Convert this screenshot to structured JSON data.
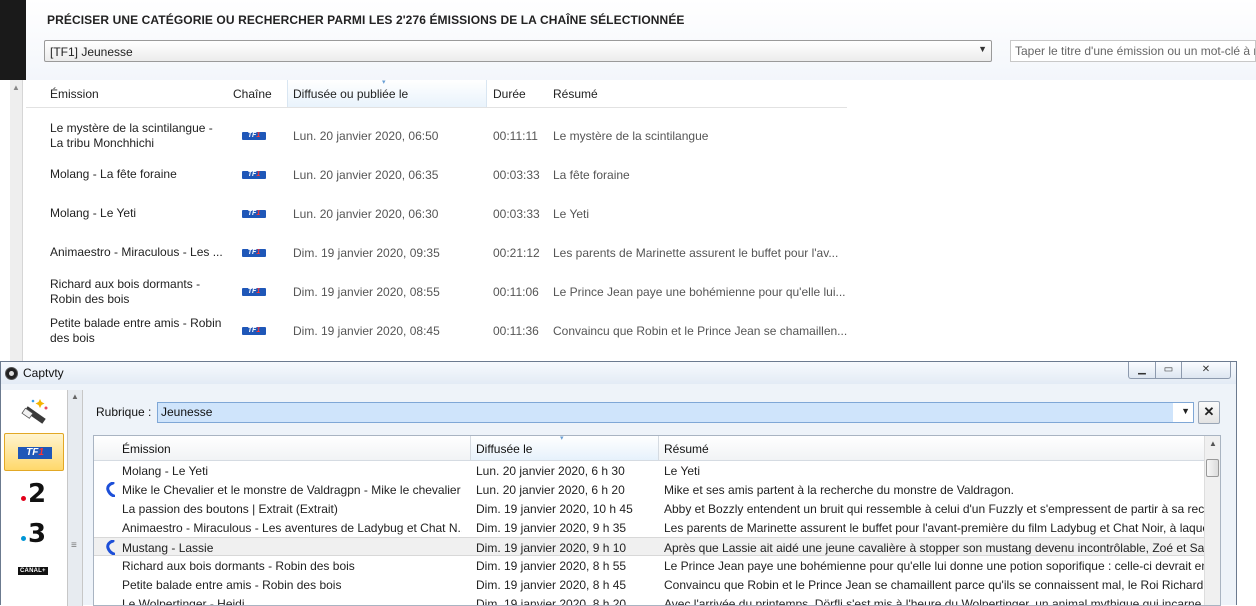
{
  "background": {
    "title": "PRÉCISER UNE CATÉGORIE OU RECHERCHER PARMI LES 2'276 ÉMISSIONS DE LA CHAÎNE SÉLECTIONNÉE",
    "category_select": "[TF1] Jeunesse",
    "search_placeholder": "Taper le titre d'une émission ou un mot-clé à r",
    "columns": [
      "Émission",
      "Chaîne",
      "Diffusée ou publiée le",
      "Durée",
      "Résumé"
    ],
    "rows": [
      {
        "title": "Le mystère de la scintilangue - La tribu Monchhichi",
        "channel": "TF1",
        "date": "Lun. 20 janvier 2020, 06:50",
        "duration": "00:11:11",
        "summary": "Le mystère de la scintilangue"
      },
      {
        "title": "Molang - La fête foraine",
        "channel": "TF1",
        "date": "Lun. 20 janvier 2020, 06:35",
        "duration": "00:03:33",
        "summary": "La fête foraine"
      },
      {
        "title": "Molang - Le Yeti",
        "channel": "TF1",
        "date": "Lun. 20 janvier 2020, 06:30",
        "duration": "00:03:33",
        "summary": "Le Yeti"
      },
      {
        "title": "Animaestro - Miraculous - Les ...",
        "channel": "TF1",
        "date": "Dim. 19 janvier 2020, 09:35",
        "duration": "00:21:12",
        "summary": "Les parents de Marinette assurent le buffet pour l'av..."
      },
      {
        "title": "Richard aux bois dormants - Robin des bois",
        "channel": "TF1",
        "date": "Dim. 19 janvier 2020, 08:55",
        "duration": "00:11:06",
        "summary": "Le Prince Jean paye une bohémienne pour qu'elle lui..."
      },
      {
        "title": "Petite balade entre amis - Robin des bois",
        "channel": "TF1",
        "date": "Dim. 19 janvier 2020, 08:45",
        "duration": "00:11:36",
        "summary": "Convaincu que Robin et le Prince Jean se chamaillen..."
      }
    ]
  },
  "window": {
    "title": "Captvty",
    "min_glyph": "▁",
    "max_glyph": "▭",
    "close_glyph": "✕",
    "rubrique_label": "Rubrique :",
    "rubrique_value": "Jeunesse",
    "clear_glyph": "✕",
    "channels": [
      {
        "name": "tools",
        "icon": "magic-wand-icon"
      },
      {
        "name": "TF1",
        "selected": true
      },
      {
        "name": "France 2",
        "label": "2"
      },
      {
        "name": "France 3",
        "label": "3"
      },
      {
        "name": "CANAL+",
        "label": "CANAL+"
      }
    ],
    "columns": [
      "Émission",
      "Diffusée le",
      "Résumé"
    ],
    "rows": [
      {
        "title": "Molang - Le Yeti",
        "date": "Lun. 20 janvier 2020, 6 h 30",
        "summary": "Le Yeti",
        "flag": false
      },
      {
        "title": "Mike le Chevalier et le monstre de Valdragpn - Mike le chevalier",
        "date": "Lun. 20 janvier 2020, 6 h 20",
        "summary": "Mike et ses amis partent à la recherche du monstre de Valdragon.",
        "flag": true
      },
      {
        "title": "La passion des boutons | Extrait (Extrait)",
        "date": "Dim. 19 janvier 2020, 10 h 45",
        "summary": "Abby et Bozzly entendent un bruit qui ressemble à celui d'un Fuzzly et s'empressent de partir à sa reche",
        "flag": false
      },
      {
        "title": "Animaestro - Miraculous - Les aventures de Ladybug et Chat N...",
        "date": "Dim. 19 janvier 2020, 9 h 35",
        "summary": "Les parents de Marinette assurent le buffet pour l'avant-première du film Ladybug et Chat Noir, à laque",
        "flag": false
      },
      {
        "title": "Mustang - Lassie",
        "date": "Dim. 19 janvier 2020, 9 h 10",
        "summary": "Après que Lassie ait aidé une jeune cavalière à stopper son mustang devenu incontrôlable, Zoé et Sarah",
        "flag": true,
        "selected": true
      },
      {
        "title": "Richard aux bois dormants - Robin des bois",
        "date": "Dim. 19 janvier 2020, 8 h 55",
        "summary": "Le Prince Jean paye une bohémienne pour qu'elle lui donne une potion soporifique : celle-ci devrait en",
        "flag": false
      },
      {
        "title": "Petite balade entre amis - Robin des bois",
        "date": "Dim. 19 janvier 2020, 8 h 45",
        "summary": "Convaincu que Robin et le Prince Jean se chamaillent parce qu'ils se connaissent mal, le Roi Richard or",
        "flag": false
      },
      {
        "title": "Le Wolpertinger - Heidi",
        "date": "Dim. 19 janvier 2020, 8 h 20",
        "summary": "Avec l'arrivée du printemps, Dörfli s'est mis à l'heure du Wolpertinger, un animal mythique qui incarne",
        "flag": false
      }
    ]
  },
  "colors": {
    "accent": "#1f57b8",
    "selection": "#cfe4fb",
    "flag": "#1d4fd8",
    "tf1_selected": "#ffd86b"
  }
}
